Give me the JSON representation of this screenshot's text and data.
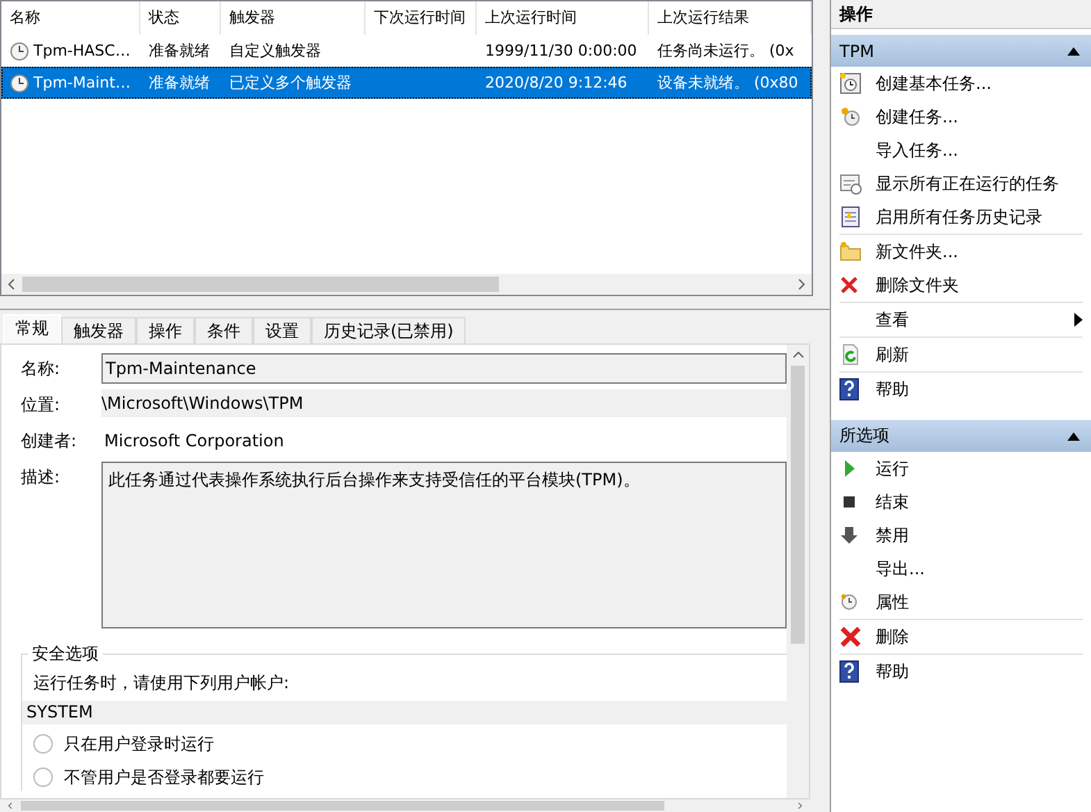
{
  "task_list": {
    "columns": [
      "名称",
      "状态",
      "触发器",
      "下次运行时间",
      "上次运行时间",
      "上次运行结果"
    ],
    "rows": [
      {
        "name": "Tpm-HASC…",
        "status": "准备就绪",
        "trigger": "自定义触发器",
        "next_run": "",
        "last_run": "1999/11/30 0:00:00",
        "last_result": "任务尚未运行。 (0x",
        "selected": false
      },
      {
        "name": "Tpm-Maint…",
        "status": "准备就绪",
        "trigger": "已定义多个触发器",
        "next_run": "",
        "last_run": "2020/8/20 9:12:46",
        "last_result": "设备未就绪。 (0x80",
        "selected": true
      }
    ]
  },
  "detail_tabs": [
    {
      "label": "常规",
      "selected": true
    },
    {
      "label": "触发器",
      "selected": false
    },
    {
      "label": "操作",
      "selected": false
    },
    {
      "label": "条件",
      "selected": false
    },
    {
      "label": "设置",
      "selected": false
    },
    {
      "label": "历史记录(已禁用)",
      "selected": false
    }
  ],
  "general": {
    "name_label": "名称:",
    "name_value": "Tpm-Maintenance",
    "location_label": "位置:",
    "location_value": "\\Microsoft\\Windows\\TPM",
    "author_label": "创建者:",
    "author_value": "Microsoft Corporation",
    "description_label": "描述:",
    "description_value": "此任务通过代表操作系统执行后台操作来支持受信任的平台模块(TPM)。",
    "security": {
      "title": "安全选项",
      "account_label": "运行任务时，请使用下列用户帐户:",
      "account_value": "SYSTEM",
      "options": [
        {
          "label": "只在用户登录时运行",
          "selected": false
        },
        {
          "label": "不管用户是否登录都要运行",
          "selected": false
        }
      ]
    }
  },
  "actions_pane": {
    "title": "操作",
    "sections": [
      {
        "title": "TPM",
        "expanded": true,
        "items": [
          {
            "label": "创建基本任务...",
            "separator_before": false,
            "submenu": false
          },
          {
            "label": "创建任务...",
            "separator_before": false,
            "submenu": false
          },
          {
            "label": "导入任务...",
            "separator_before": false,
            "submenu": false
          },
          {
            "label": "显示所有正在运行的任务",
            "separator_before": false,
            "submenu": false
          },
          {
            "label": "启用所有任务历史记录",
            "separator_before": false,
            "submenu": false
          },
          {
            "label": "新文件夹...",
            "separator_before": true,
            "submenu": false
          },
          {
            "label": "删除文件夹",
            "separator_before": false,
            "submenu": false
          },
          {
            "label": "查看",
            "separator_before": true,
            "submenu": true
          },
          {
            "label": "刷新",
            "separator_before": true,
            "submenu": false
          },
          {
            "label": "帮助",
            "separator_before": true,
            "submenu": false
          }
        ]
      },
      {
        "title": "所选项",
        "expanded": true,
        "items": [
          {
            "label": "运行",
            "separator_before": false,
            "submenu": false
          },
          {
            "label": "结束",
            "separator_before": false,
            "submenu": false
          },
          {
            "label": "禁用",
            "separator_before": false,
            "submenu": false
          },
          {
            "label": "导出...",
            "separator_before": false,
            "submenu": false
          },
          {
            "label": "属性",
            "separator_before": false,
            "submenu": false
          },
          {
            "label": "删除",
            "separator_before": true,
            "submenu": false
          },
          {
            "label": "帮助",
            "separator_before": true,
            "submenu": false
          }
        ]
      }
    ]
  }
}
